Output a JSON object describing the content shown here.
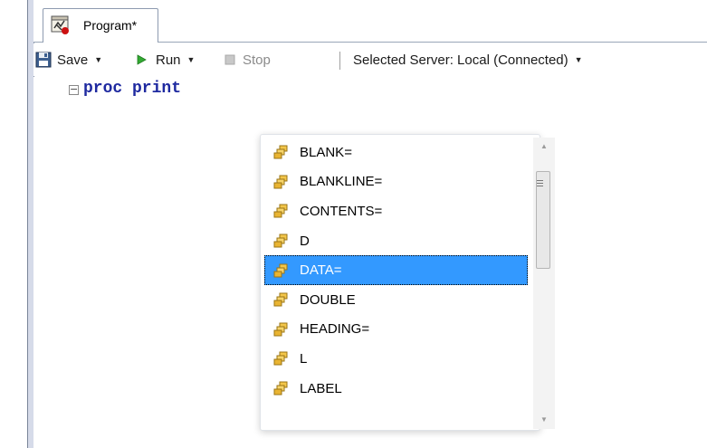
{
  "tab": {
    "label": "Program*"
  },
  "toolbar": {
    "save_label": "Save",
    "run_label": "Run",
    "stop_label": "Stop",
    "server_label": "Selected Server: Local (Connected)"
  },
  "editor": {
    "fold_symbol": "−",
    "code_line": "proc print"
  },
  "autocomplete": {
    "items": [
      {
        "label": "BLANK="
      },
      {
        "label": "BLANKLINE="
      },
      {
        "label": "CONTENTS="
      },
      {
        "label": "D"
      },
      {
        "label": "DATA="
      },
      {
        "label": "DOUBLE"
      },
      {
        "label": "HEADING="
      },
      {
        "label": "L"
      },
      {
        "label": "LABEL"
      }
    ],
    "selected_label": "DATA="
  },
  "colors": {
    "code_keyword": "#1f2aa0",
    "selection": "#3399ff",
    "run_icon": "#33aa33"
  },
  "icons": {
    "tab": "sas-program-icon",
    "save": "floppy-disk-icon",
    "run": "play-triangle-icon",
    "stop": "stop-square-icon",
    "keyword": "keyword-option-icon"
  }
}
